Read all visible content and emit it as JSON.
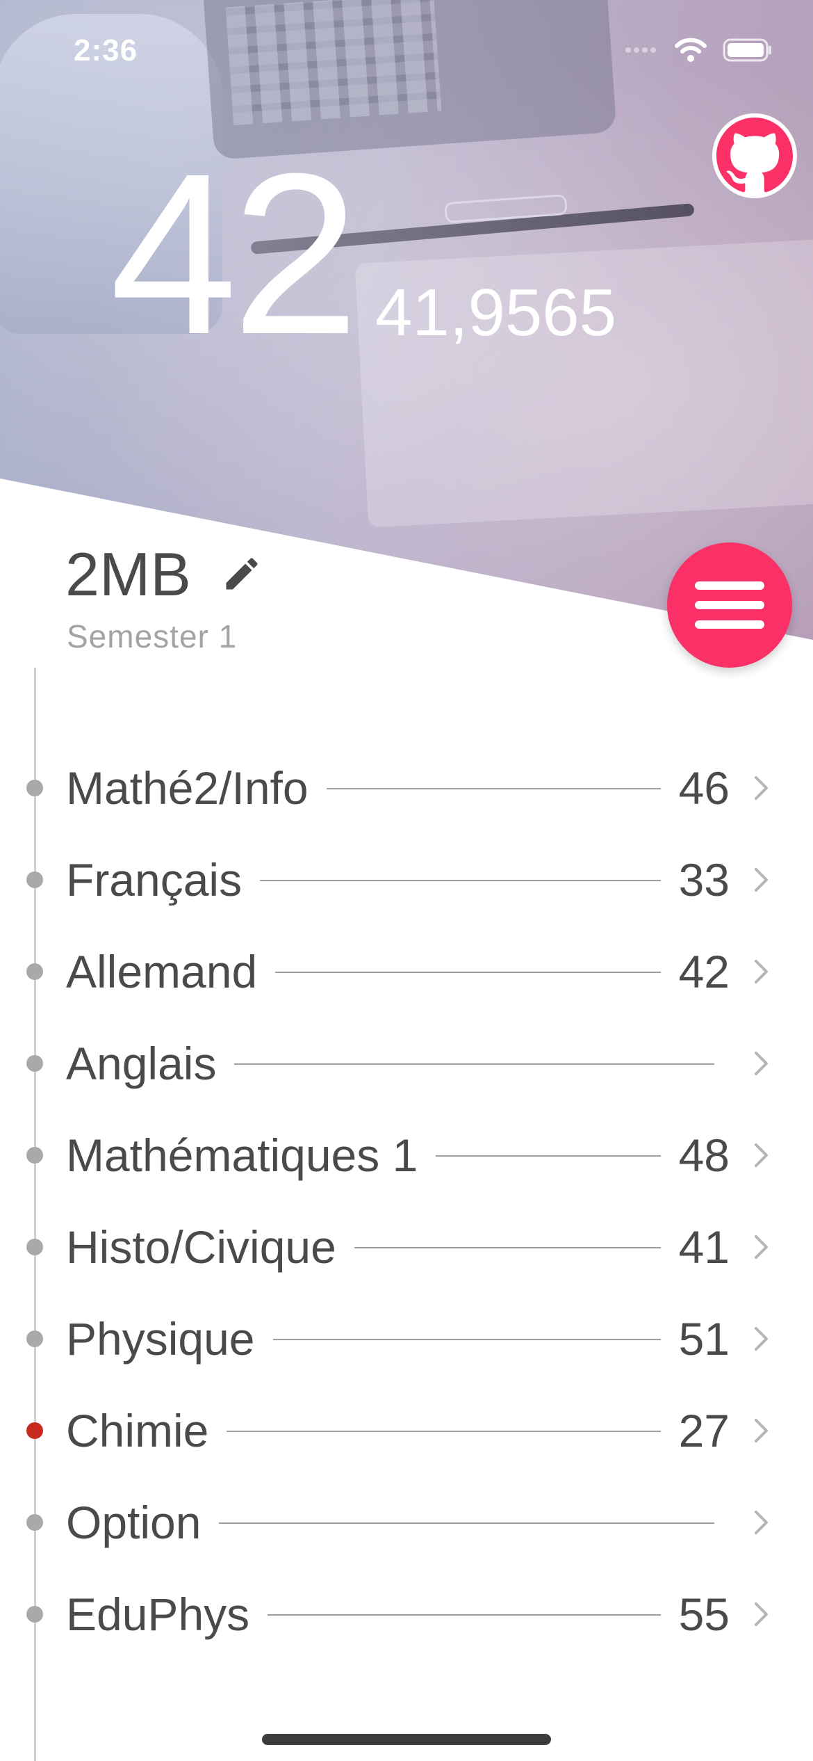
{
  "status_bar": {
    "time": "2:36"
  },
  "header": {
    "grade": "42",
    "average": "41,9565",
    "github_icon": "github-icon"
  },
  "class": {
    "name": "2MB",
    "semester": "Semester 1"
  },
  "colors": {
    "accent": "#fb3066",
    "timeline_dot": "#a9a9a9",
    "alert_dot": "#c72a1e"
  },
  "subjects": [
    {
      "name": "Mathé2/Info",
      "grade": "46",
      "alert": false
    },
    {
      "name": "Français",
      "grade": "33",
      "alert": false
    },
    {
      "name": "Allemand",
      "grade": "42",
      "alert": false
    },
    {
      "name": "Anglais",
      "grade": "",
      "alert": false
    },
    {
      "name": "Mathématiques 1",
      "grade": "48",
      "alert": false
    },
    {
      "name": "Histo/Civique",
      "grade": "41",
      "alert": false
    },
    {
      "name": "Physique",
      "grade": "51",
      "alert": false
    },
    {
      "name": "Chimie",
      "grade": "27",
      "alert": true
    },
    {
      "name": "Option",
      "grade": "",
      "alert": false
    },
    {
      "name": "EduPhys",
      "grade": "55",
      "alert": false
    }
  ]
}
